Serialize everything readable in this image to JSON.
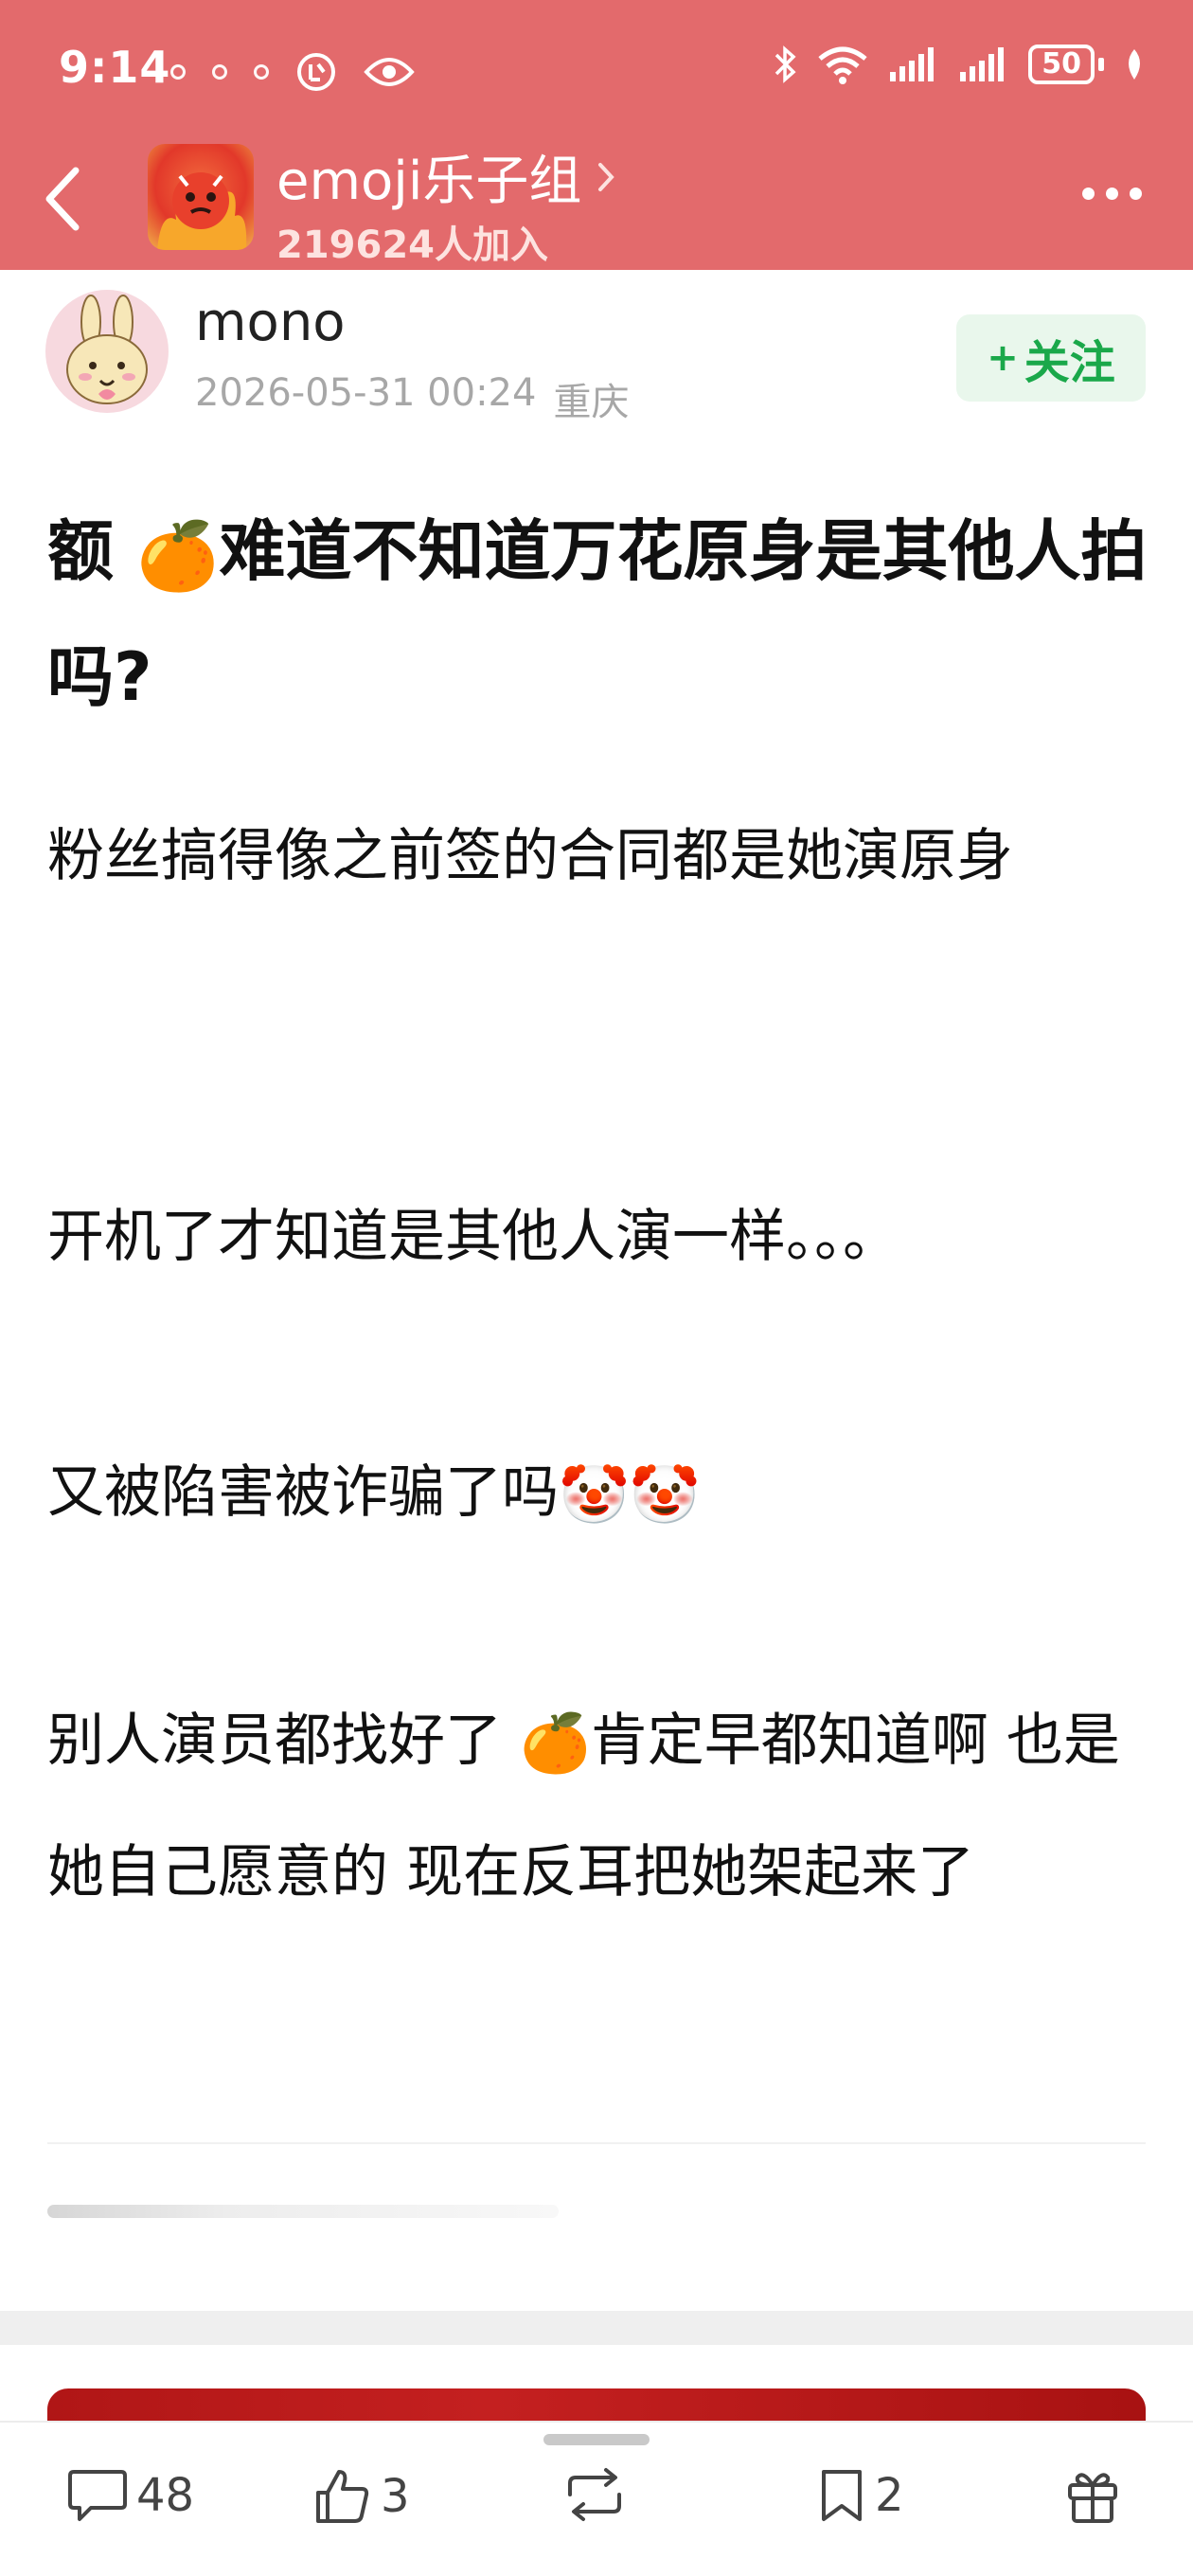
{
  "status_bar": {
    "time": "9:14",
    "battery": "50",
    "icons": [
      "notification-icon",
      "notification-icon",
      "notification-icon",
      "data-saver-icon",
      "eye-icon",
      "bluetooth-icon",
      "wifi-icon",
      "signal-icon",
      "signal-icon",
      "battery-icon",
      "charging-leaf-icon"
    ]
  },
  "group": {
    "name": "emoji乐子组",
    "members": "219624人加入"
  },
  "post": {
    "author": "mono",
    "date": "2026-05-31 00:24",
    "location": "重庆",
    "follow_label": "关注",
    "title_pre": "额 ",
    "title_emoji": "🍊",
    "title_post": "难道不知道万花原身是其他人拍吗?",
    "paragraphs": {
      "p1": "粉丝搞得像之前签的合同都是她演原身",
      "p2": "开机了才知道是其他人演一样。。。",
      "p3_text": "又被陷害被诈骗了吗",
      "p3_emoji": "🤡🤡",
      "p4_pre": "别人演员都找好了 ",
      "p4_emoji": "🍊",
      "p4_post": "肯定早都知道啊  也是她自己愿意的  现在反耳把她架起来了"
    }
  },
  "actions": {
    "comments": "48",
    "likes": "3",
    "favorites": "2"
  },
  "colors": {
    "header_bg": "#e36a6c",
    "follow_green": "#1aa84a",
    "follow_bg": "#e9f7ec",
    "banner_red": "#b01616"
  }
}
